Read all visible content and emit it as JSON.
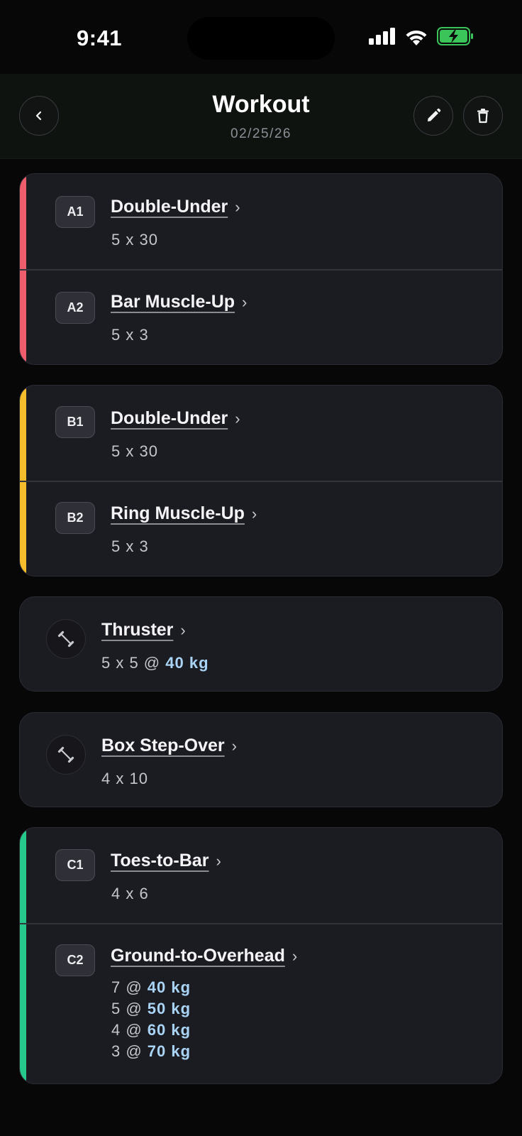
{
  "status": {
    "time": "9:41"
  },
  "header": {
    "title": "Workout",
    "date": "02/25/26"
  },
  "colors": {
    "superset_a": "#ee5d6c",
    "superset_b": "#f5bd2c",
    "superset_c": "#27c88b",
    "weight": "#a9d4f5"
  },
  "icons": {
    "back": "chevron-left-icon",
    "edit": "pencil-icon",
    "delete": "trash-icon",
    "exercise": "dumbbell-icon"
  },
  "cards": {
    "a": {
      "items": [
        {
          "badge": "A1",
          "name": "Double-Under",
          "detail": "5 x 30"
        },
        {
          "badge": "A2",
          "name": "Bar Muscle-Up",
          "detail": "5 x 3"
        }
      ]
    },
    "b": {
      "items": [
        {
          "badge": "B1",
          "name": "Double-Under",
          "detail": "5 x 30"
        },
        {
          "badge": "B2",
          "name": "Ring Muscle-Up",
          "detail": "5 x 3"
        }
      ]
    },
    "thruster": {
      "name": "Thruster",
      "detail_prefix": "5 x 5 @ ",
      "weight": "40 kg"
    },
    "box": {
      "name": "Box Step-Over",
      "detail": "4 x 10"
    },
    "c": {
      "items": [
        {
          "badge": "C1",
          "name": "Toes-to-Bar",
          "detail": "4 x 6"
        },
        {
          "badge": "C2",
          "name": "Ground-to-Overhead",
          "sets": [
            {
              "prefix": "7 @ ",
              "weight": "40 kg"
            },
            {
              "prefix": "5 @ ",
              "weight": "50 kg"
            },
            {
              "prefix": "4 @ ",
              "weight": "60 kg"
            },
            {
              "prefix": "3 @ ",
              "weight": "70 kg"
            }
          ]
        }
      ]
    }
  }
}
